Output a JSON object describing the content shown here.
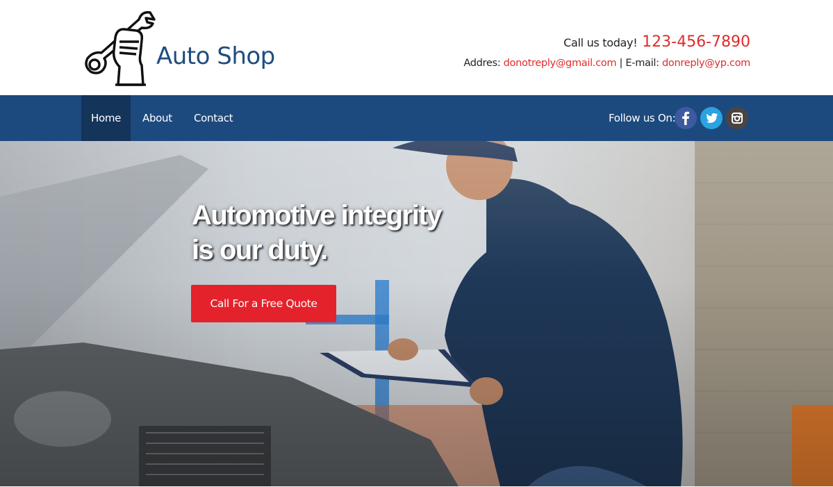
{
  "brand": {
    "name": "Auto Shop"
  },
  "contact": {
    "call_label": "Call us today!",
    "phone": "123-456-7890",
    "address_label": "Addres:",
    "address_link": "donotreply@gmail.com",
    "separator": "|",
    "email_label": "E-mail:",
    "email_link": "donreply@yp.com"
  },
  "nav": {
    "items": [
      {
        "label": "Home",
        "active": true
      },
      {
        "label": "About",
        "active": false
      },
      {
        "label": "Contact",
        "active": false
      }
    ],
    "follow_label": "Follow us On:",
    "social": [
      "facebook-icon",
      "twitter-icon",
      "instagram-icon"
    ]
  },
  "hero": {
    "headline_line1": "Automotive integrity",
    "headline_line2": "is our duty.",
    "cta_label": "Call For a Free Quote"
  },
  "colors": {
    "brand_blue": "#1e4d80",
    "nav_bg": "#1d4a7e",
    "nav_active": "#14345a",
    "accent_red": "#e02b2b",
    "cta_red": "#e3222b"
  }
}
